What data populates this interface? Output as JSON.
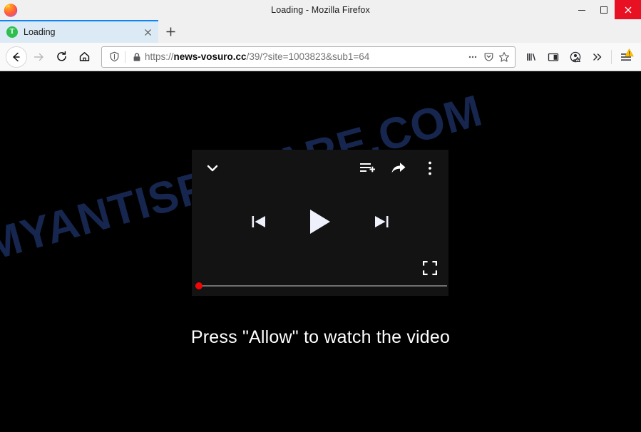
{
  "window": {
    "title": "Loading - Mozilla Firefox",
    "logo_icon": "firefox-logo-icon",
    "controls": {
      "minimize": "minimize-icon",
      "maximize": "maximize-icon",
      "close": "close-icon",
      "close_color": "#e81123"
    }
  },
  "tabs": [
    {
      "label": "Loading",
      "favicon_letter": "T",
      "favicon_color": "#2cbe4e",
      "active": true,
      "close_icon": "close-icon"
    }
  ],
  "newtab": {
    "label": "+",
    "icon": "plus-icon"
  },
  "navbar": {
    "back": "back-arrow-icon",
    "forward": "forward-arrow-icon",
    "reload": "reload-icon",
    "home": "home-icon",
    "shield": "shield-icon",
    "lock": "padlock-icon",
    "page_actions": "ellipsis-icon",
    "pocket": "pocket-icon",
    "bookmark": "star-icon",
    "url": {
      "scheme": "https://",
      "host": "news-vosuro.cc",
      "path": "/39/?site=1003823&sub1=64",
      "full": "https://news-vosuro.cc/39/?site=1003823&sub1=64"
    }
  },
  "toolbar_right": {
    "library": "library-icon",
    "sidebar": "sidebar-icon",
    "account": "account-warning-icon",
    "overflow": "double-chevron-icon",
    "menu": "hamburger-menu-icon",
    "menu_badge": "warning-triangle-icon",
    "badge_color": "#ffbf00"
  },
  "page": {
    "background_color": "#000000",
    "watermark": "MYANTISPYWARE.COM",
    "watermark_color": "#16264f",
    "allow_message": "Press \"Allow\" to watch the video",
    "player": {
      "background_color": "#131313",
      "collapse": "chevron-down-icon",
      "playlist_add": "playlist-add-icon",
      "share": "share-arrow-icon",
      "more": "three-dot-vertical-icon",
      "previous": "previous-track-icon",
      "play": "play-icon",
      "next": "next-track-icon",
      "fullscreen": "fullscreen-icon",
      "progress_percent": 0,
      "scrubber_color": "#f00606",
      "track_color": "#6f6f6f"
    }
  }
}
